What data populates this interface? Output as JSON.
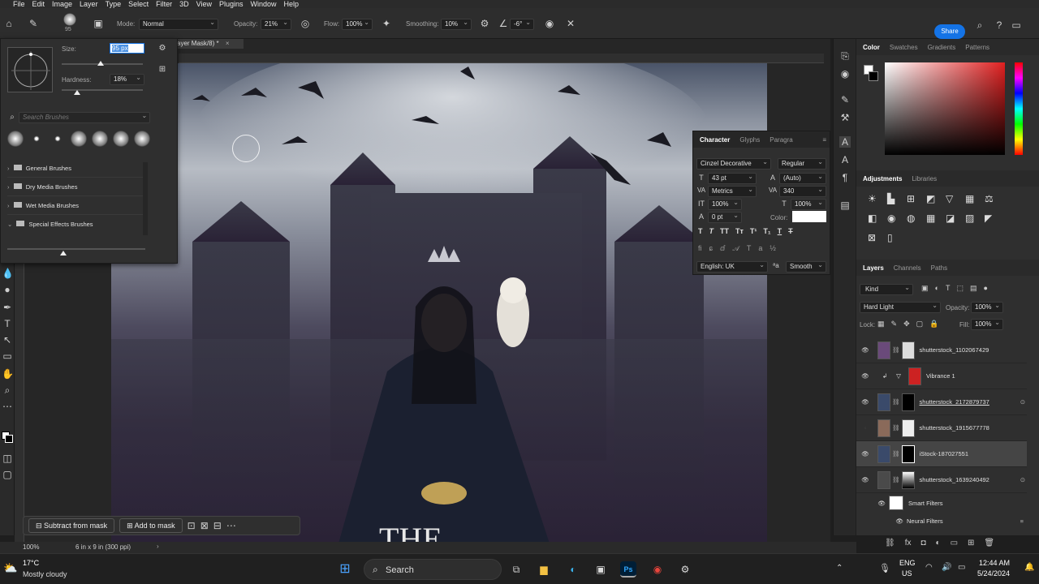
{
  "menu": [
    "File",
    "Edit",
    "Image",
    "Layer",
    "Type",
    "Select",
    "Filter",
    "3D",
    "View",
    "Plugins",
    "Window",
    "Help"
  ],
  "options": {
    "brush_size_badge": "95",
    "mode_label": "Mode:",
    "mode_value": "Normal",
    "opacity_label": "Opacity:",
    "opacity_value": "21%",
    "flow_label": "Flow:",
    "flow_value": "100%",
    "smoothing_label": "Smoothing:",
    "smoothing_value": "10%",
    "angle_value": "-6°",
    "share_label": "Share"
  },
  "doc_tab": "ayer Mask/8) *",
  "brush_panel": {
    "size_label": "Size:",
    "size_value": "95 px",
    "hardness_label": "Hardness:",
    "hardness_value": "18%",
    "search_placeholder": "Search Brushes",
    "folders": [
      "General Brushes",
      "Dry Media Brushes",
      "Wet Media Brushes",
      "Special Effects Brushes"
    ]
  },
  "character": {
    "tabs": [
      "Character",
      "Glyphs",
      "Paragra"
    ],
    "font_family": "Cinzel Decorative",
    "font_style": "Regular",
    "font_size": "43 pt",
    "leading": "(Auto)",
    "kerning": "Metrics",
    "tracking": "340",
    "vscale": "100%",
    "hscale": "100%",
    "baseline": "0 pt",
    "color_label": "Color:",
    "language": "English: UK",
    "antialias": "Smooth"
  },
  "color_panel": {
    "tabs": [
      "Color",
      "Swatches",
      "Gradients",
      "Patterns"
    ]
  },
  "adjustments_panel": {
    "tabs": [
      "Adjustments",
      "Libraries"
    ]
  },
  "layers_panel": {
    "tabs": [
      "Layers",
      "Channels",
      "Paths"
    ],
    "filter_kind": "Kind",
    "blend_mode": "Hard Light",
    "opacity_label": "Opacity:",
    "opacity_value": "100%",
    "lock_label": "Lock:",
    "fill_label": "Fill:",
    "fill_value": "100%",
    "layers": [
      {
        "name": "shutterstock_1102067429"
      },
      {
        "name": "Vibrance 1"
      },
      {
        "name": "shutterstock_2172879737"
      },
      {
        "name": "shutterstock_1915677778"
      },
      {
        "name": "iStock-187027551"
      },
      {
        "name": "shutterstock_1639240492"
      }
    ],
    "smart_filters": "Smart Filters",
    "neural_filters": "Neural Filters"
  },
  "mask_bar": {
    "subtract": "Subtract from mask",
    "add": "Add to mask"
  },
  "status": {
    "zoom": "100%",
    "doc_size": "6 in x 9 in (300 ppi)"
  },
  "taskbar": {
    "temp": "17°C",
    "weather": "Mostly cloudy",
    "search": "Search",
    "lang": "ENG",
    "region": "US",
    "time": "12:44 AM",
    "date": "5/24/2024"
  }
}
